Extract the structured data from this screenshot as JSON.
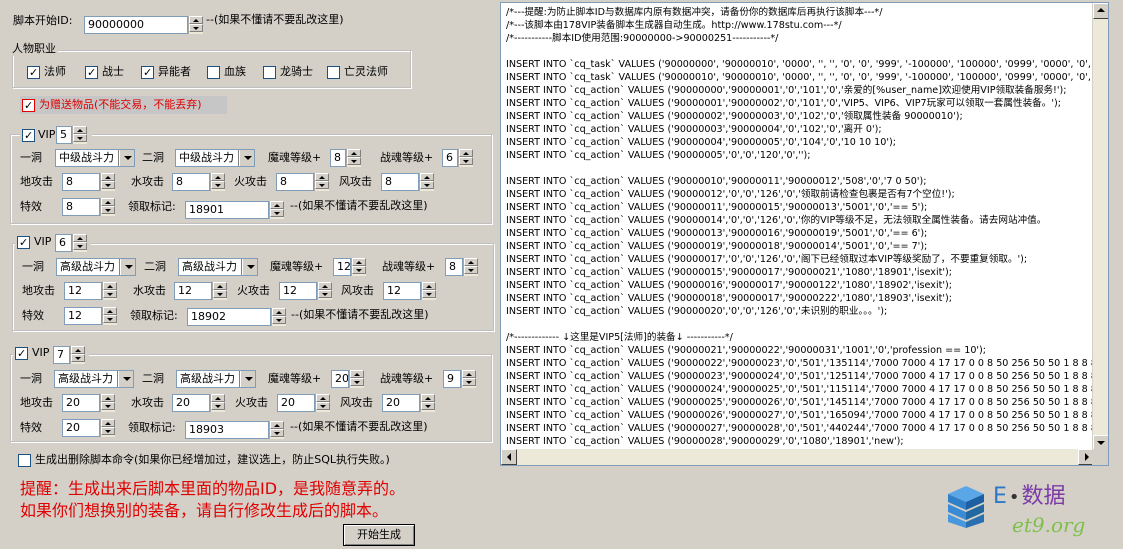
{
  "script_start": {
    "label": "脚本开始ID:",
    "value": "90000000",
    "hint": "--(如果不懂请不要乱改这里)"
  },
  "profession": {
    "group_label": "人物职业",
    "items": [
      {
        "label": "法师",
        "checked": true
      },
      {
        "label": "战士",
        "checked": true
      },
      {
        "label": "异能者",
        "checked": true
      },
      {
        "label": "血族",
        "checked": false
      },
      {
        "label": "龙骑士",
        "checked": false
      },
      {
        "label": "亡灵法师",
        "checked": false
      }
    ]
  },
  "gift_label": "为赠送物品(不能交易，不能丢弃)",
  "vip_groups": [
    {
      "vip_label": "VIP",
      "vip_value": "5",
      "cave1_label": "一洞",
      "cave1_value": "中级战斗力",
      "cave2_label": "二洞",
      "cave2_value": "中级战斗力",
      "soul_label": "魔魂等级+",
      "soul_value": "8",
      "war_label": "战魂等级+",
      "war_value": "6",
      "earth_label": "地攻击",
      "earth_value": "8",
      "water_label": "水攻击",
      "water_value": "8",
      "fire_label": "火攻击",
      "fire_value": "8",
      "wind_label": "风攻击",
      "wind_value": "8",
      "effect_label": "特效",
      "effect_value": "8",
      "mark_label": "领取标记:",
      "mark_value": "18901",
      "hint": "--(如果不懂请不要乱改这里)"
    },
    {
      "vip_label": "VIP",
      "vip_value": "6",
      "cave1_label": "一洞",
      "cave1_value": "高级战斗力",
      "cave2_label": "二洞",
      "cave2_value": "高级战斗力",
      "soul_label": "魔魂等级+",
      "soul_value": "12",
      "war_label": "战魂等级+",
      "war_value": "8",
      "earth_label": "地攻击",
      "earth_value": "12",
      "water_label": "水攻击",
      "water_value": "12",
      "fire_label": "火攻击",
      "fire_value": "12",
      "wind_label": "风攻击",
      "wind_value": "12",
      "effect_label": "特效",
      "effect_value": "12",
      "mark_label": "领取标记:",
      "mark_value": "18902",
      "hint": "--(如果不懂请不要乱改这里)"
    },
    {
      "vip_label": "VIP",
      "vip_value": "7",
      "cave1_label": "一洞",
      "cave1_value": "高级战斗力",
      "cave2_label": "二洞",
      "cave2_value": "高级战斗力",
      "soul_label": "魔魂等级+",
      "soul_value": "20",
      "war_label": "战魂等级+",
      "war_value": "9",
      "earth_label": "地攻击",
      "earth_value": "20",
      "water_label": "水攻击",
      "water_value": "20",
      "fire_label": "火攻击",
      "fire_value": "20",
      "wind_label": "风攻击",
      "wind_value": "20",
      "effect_label": "特效",
      "effect_value": "20",
      "mark_label": "领取标记:",
      "mark_value": "18903",
      "hint": "--(如果不懂请不要乱改这里)"
    }
  ],
  "delete_cmd_label": "生成出删除脚本命令(如果你已经增加过，建议选上，防止SQL执行失败。)",
  "notice_line1": "提醒：生成出来后脚本里面的物品ID，是我随意弄的。",
  "notice_line2": "如果你们想换别的装备，请自行修改生成后的脚本。",
  "generate_button": "开始生成",
  "logo": {
    "text1": "E",
    "text2": "数据",
    "domain": "et9.org"
  },
  "code_lines": [
    "/*---提醒:为防止脚本ID与数据库内原有数据冲突，请备份你的数据库后再执行该脚本---*/",
    "/*---该脚本由178VIP装备脚本生成器自动生成。http://www.178stu.com---*/",
    "/*-----------脚本ID使用范围:90000000->90000251-----------*/",
    "",
    "INSERT INTO `cq_task` VALUES ('90000000', '90000010', '0000', '', '', '0', '0', '999', '-100000', '100000', '0999', '0000', '0', '-1",
    "INSERT INTO `cq_task` VALUES ('90000010', '90000010', '0000', '', '', '0', '0', '999', '-100000', '100000', '0999', '0000', '0', '-1",
    "INSERT INTO `cq_action` VALUES ('90000000','90000001','0','101','0','亲爱的[%user_name]欢迎使用VIP领取装备服务!');",
    "INSERT INTO `cq_action` VALUES ('90000001','90000002','0','101','0','VIP5、VIP6、VIP7玩家可以领取一套属性装备。');",
    "INSERT INTO `cq_action` VALUES ('90000002','90000003','0','102','0','领取属性装备 90000010');",
    "INSERT INTO `cq_action` VALUES ('90000003','90000004','0','102','0','离开 0');",
    "INSERT INTO `cq_action` VALUES ('90000004','90000005','0','104','0','10 10 10');",
    "INSERT INTO `cq_action` VALUES ('90000005','0','0','120','0','');",
    "",
    "INSERT INTO `cq_action` VALUES ('90000010','90000011','90000012','508','0','7 0 50');",
    "INSERT INTO `cq_action` VALUES ('90000012','0','0','126','0','领取前请检查包裹是否有7个空位!');",
    "INSERT INTO `cq_action` VALUES ('90000011','90000015','90000013','5001','0','== 5');",
    "INSERT INTO `cq_action` VALUES ('90000014','0','0','126','0','你的VIP等级不足，无法领取全属性装备。请去网站冲值。",
    "INSERT INTO `cq_action` VALUES ('90000013','90000016','90000019','5001','0','== 6');",
    "INSERT INTO `cq_action` VALUES ('90000019','90000018','90000014','5001','0','== 7');",
    "INSERT INTO `cq_action` VALUES ('90000017','0','0','126','0','阁下已经领取过本VIP等级奖励了，不要重复领取。');",
    "INSERT INTO `cq_action` VALUES ('90000015','90000017','90000021','1080','18901','isexit');",
    "INSERT INTO `cq_action` VALUES ('90000016','90000017','90000122','1080','18902','isexit');",
    "INSERT INTO `cq_action` VALUES ('90000018','90000017','90000222','1080','18903','isexit');",
    "INSERT INTO `cq_action` VALUES ('90000020','0','0','126','0','未识别的职业。。。');",
    "",
    "/*------------- ↓这里是VIP5[法师]的装备↓ -----------*/",
    "INSERT INTO `cq_action` VALUES ('90000021','90000022','90000031','1001','0','profession == 10');",
    "INSERT INTO `cq_action` VALUES ('90000022','90000023','0','501','135114','7000 7000 4 17 17 0 0 8 50 256 50 50 1 8 8 8 8",
    "INSERT INTO `cq_action` VALUES ('90000023','90000024','0','501','125114','7000 7000 4 17 17 0 0 8 50 256 50 50 1 8 8 8 8",
    "INSERT INTO `cq_action` VALUES ('90000024','90000025','0','501','115114','7000 7000 4 17 17 0 0 8 50 256 50 50 1 8 8 8 8",
    "INSERT INTO `cq_action` VALUES ('90000025','90000026','0','501','145114','7000 7000 4 17 17 0 0 8 50 256 50 50 1 8 8 8 8",
    "INSERT INTO `cq_action` VALUES ('90000026','90000027','0','501','165094','7000 7000 4 17 17 0 0 8 50 256 50 50 1 8 8 8 8",
    "INSERT INTO `cq_action` VALUES ('90000027','90000028','0','501','440244','7000 7000 4 17 17 0 0 8 50 256 50 50 1 8 8 8 8",
    "INSERT INTO `cq_action` VALUES ('90000028','90000029','0','1080','18901','new');"
  ]
}
